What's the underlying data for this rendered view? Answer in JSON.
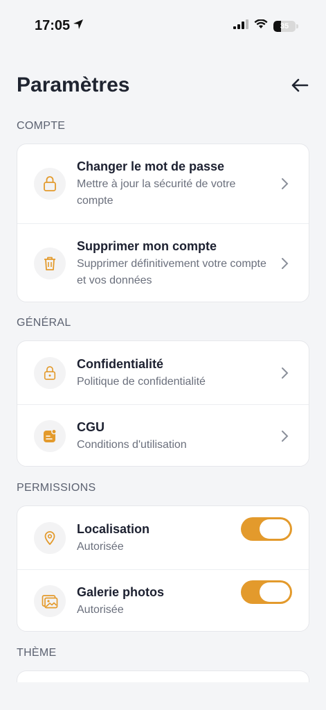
{
  "status_bar": {
    "time": "17:05",
    "battery": "35"
  },
  "header": {
    "title": "Paramètres"
  },
  "sections": {
    "account": {
      "label": "COMPTE",
      "items": [
        {
          "title": "Changer le mot de passe",
          "subtitle": "Mettre à jour la sécurité de votre compte",
          "icon": "lock-icon"
        },
        {
          "title": "Supprimer mon compte",
          "subtitle": "Supprimer définitivement votre compte et vos données",
          "icon": "trash-icon"
        }
      ]
    },
    "general": {
      "label": "GÉNÉRAL",
      "items": [
        {
          "title": "Confidentialité",
          "subtitle": "Politique de confidentialité",
          "icon": "lock-icon"
        },
        {
          "title": "CGU",
          "subtitle": "Conditions d'utilisation",
          "icon": "document-icon"
        }
      ]
    },
    "permissions": {
      "label": "PERMISSIONS",
      "items": [
        {
          "title": "Localisation",
          "subtitle": "Autorisée",
          "icon": "location-pin-icon",
          "enabled": true
        },
        {
          "title": "Galerie photos",
          "subtitle": "Autorisée",
          "icon": "photo-icon",
          "enabled": true
        }
      ]
    },
    "theme": {
      "label": "THÈME"
    }
  },
  "colors": {
    "accent": "#e39a2c",
    "background": "#f4f5f7",
    "card": "#ffffff"
  }
}
